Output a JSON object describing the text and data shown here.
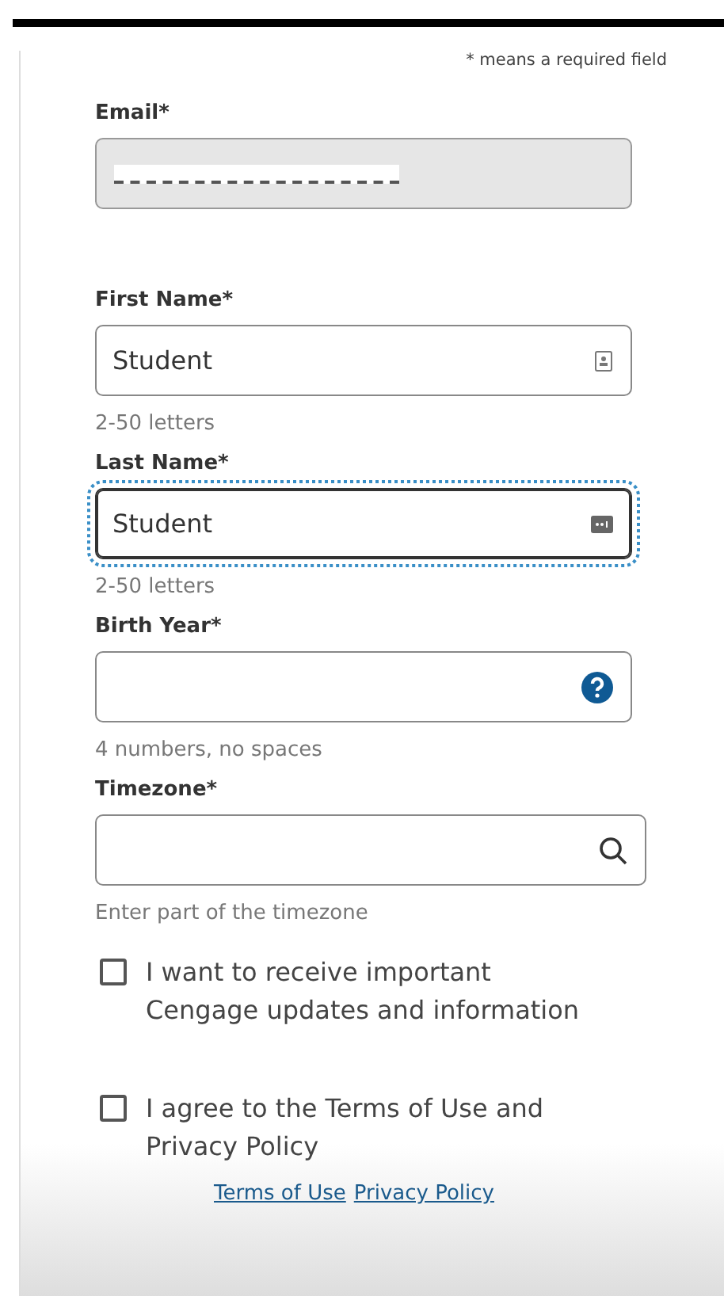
{
  "required_note": "* means a required field",
  "fields": [
    {
      "kind": "email",
      "label": "Email*",
      "disabled": true,
      "focused": false,
      "redacted": true
    },
    {
      "kind": "first",
      "label": "First Name*",
      "value": "Student",
      "disabled": false,
      "focused": false,
      "hint": "2-50 letters"
    },
    {
      "kind": "last",
      "label": "Last Name*",
      "value": "Student",
      "disabled": false,
      "focused": true,
      "hint": "2-50 letters"
    },
    {
      "kind": "year",
      "label": "Birth Year*",
      "disabled": false,
      "focused": false,
      "hint": "4 numbers, no spaces"
    },
    {
      "kind": "timezone",
      "label": "Timezone*",
      "disabled": false,
      "focused": false,
      "hint": "Enter part of the timezone"
    }
  ],
  "checkboxes": [
    {
      "label": "I want to receive important Cengage updates and information",
      "checked": false
    },
    {
      "label": "I agree to the Terms of Use and Privacy Policy",
      "checked": false
    }
  ],
  "links": [
    "Terms of Use",
    "Privacy Policy"
  ]
}
